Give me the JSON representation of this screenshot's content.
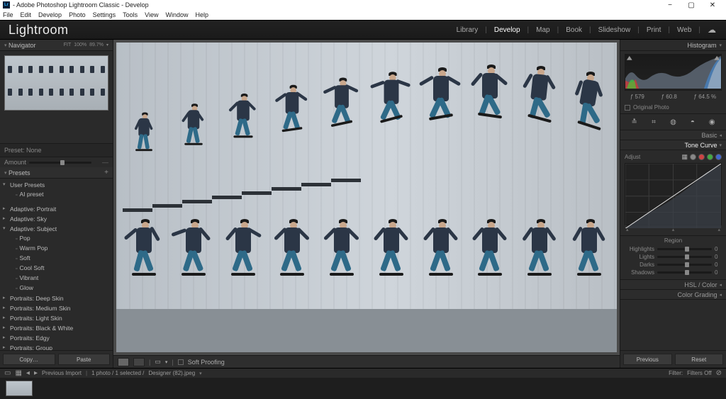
{
  "window": {
    "title": "- Adobe Photoshop Lightroom Classic - Develop",
    "app_icon": "Lr"
  },
  "menubar": [
    "File",
    "Edit",
    "Develop",
    "Photo",
    "Settings",
    "Tools",
    "View",
    "Window",
    "Help"
  ],
  "brand": "Lightroom",
  "modules": {
    "items": [
      "Library",
      "Develop",
      "Map",
      "Book",
      "Slideshow",
      "Print",
      "Web"
    ],
    "active": "Develop"
  },
  "navigator": {
    "title": "Navigator",
    "mode": "FIT",
    "zoom1": "100%",
    "zoom2": "89.7%"
  },
  "preset": {
    "label": "Preset:",
    "value": "None",
    "amount_label": "Amount"
  },
  "presets": {
    "title": "Presets",
    "user_presets": "User Presets",
    "user_items": [
      "AI preset"
    ],
    "groups": [
      {
        "label": "Adaptive: Portrait",
        "expanded": false
      },
      {
        "label": "Adaptive: Sky",
        "expanded": false
      },
      {
        "label": "Adaptive: Subject",
        "expanded": true,
        "children": [
          "Pop",
          "Warm Pop",
          "Soft",
          "Cool Soft",
          "Vibrant",
          "Glow"
        ]
      },
      {
        "label": "Portraits: Deep Skin",
        "expanded": false
      },
      {
        "label": "Portraits: Medium Skin",
        "expanded": false
      },
      {
        "label": "Portraits: Light Skin",
        "expanded": false
      },
      {
        "label": "Portraits: Black & White",
        "expanded": false
      },
      {
        "label": "Portraits: Edgy",
        "expanded": false
      },
      {
        "label": "Portraits: Group",
        "expanded": false
      }
    ],
    "copy": "Copy…",
    "paste": "Paste"
  },
  "center_toolbar": {
    "soft_proof": "Soft Proofing"
  },
  "right": {
    "histogram_title": "Histogram",
    "hist_vals": {
      "a": "579",
      "b": "60.8",
      "c": "64.5 %"
    },
    "original": "Original Photo",
    "basic": "Basic",
    "tone_curve": "Tone Curve",
    "adjust": "Adjust",
    "region_title": "Region",
    "regions": [
      {
        "label": "Highlights",
        "val": "0"
      },
      {
        "label": "Lights",
        "val": "0"
      },
      {
        "label": "Darks",
        "val": "0"
      },
      {
        "label": "Shadows",
        "val": "0"
      }
    ],
    "hsl": "HSL / Color",
    "color_grading": "Color Grading",
    "previous": "Previous",
    "reset": "Reset"
  },
  "filmstrip": {
    "prev_import": "Previous Import",
    "count": "1 photo / 1 selected /",
    "filename": "Designer (82).jpeg",
    "filter": "Filter:",
    "filters_off": "Filters Off"
  }
}
